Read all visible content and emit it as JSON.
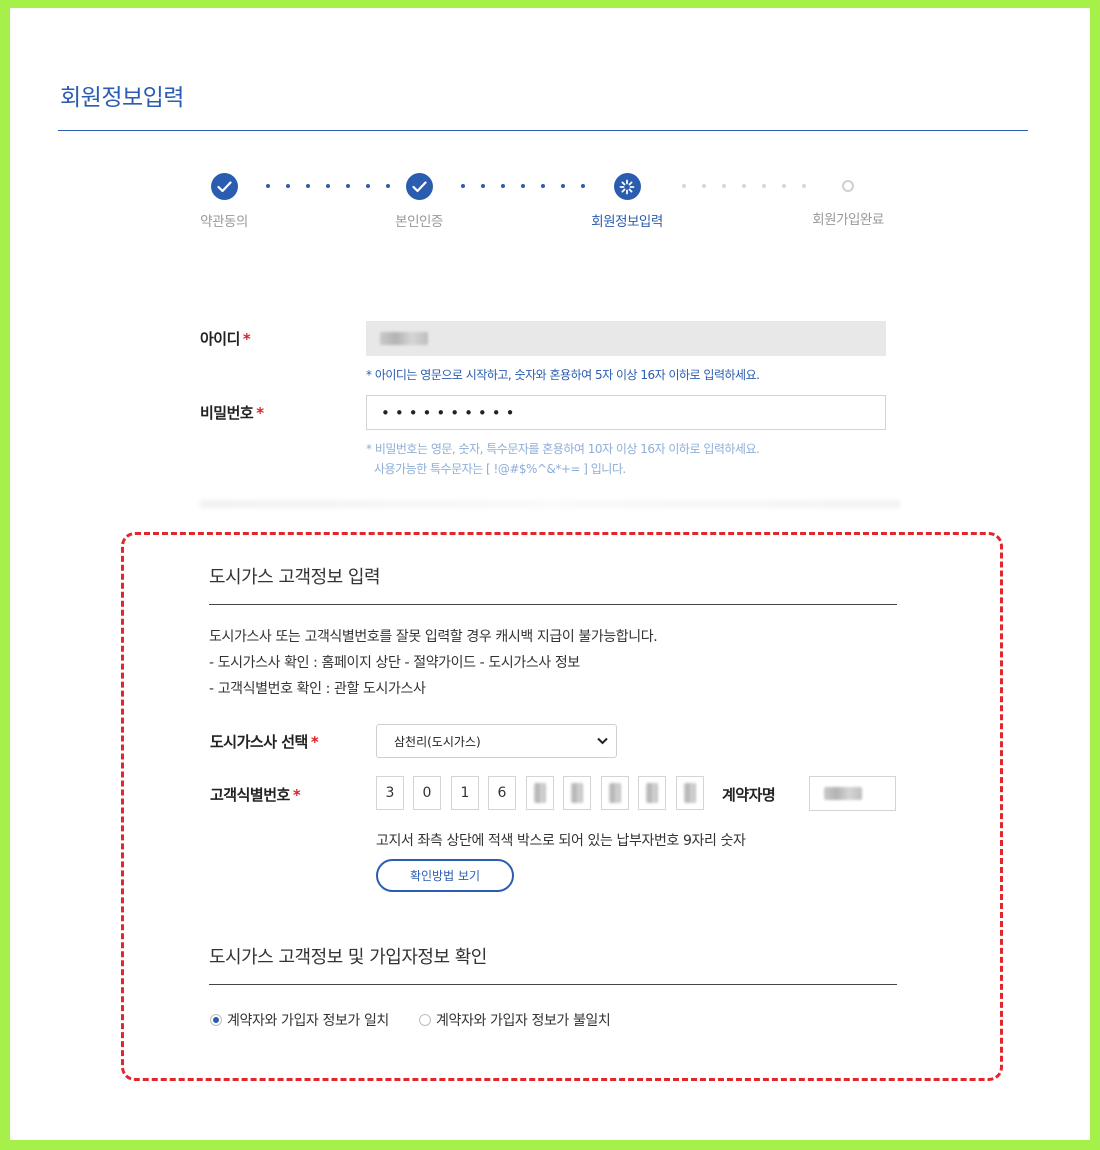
{
  "page_title": "회원정보입력",
  "steps": [
    {
      "label": "약관동의",
      "state": "done"
    },
    {
      "label": "본인인증",
      "state": "done"
    },
    {
      "label": "회원정보입력",
      "state": "active"
    },
    {
      "label": "회원가입완료",
      "state": "pending"
    }
  ],
  "form": {
    "id_label": "아이디",
    "id_hint": "* 아이디는 영문으로 시작하고, 숫자와 혼용하여 5자 이상 16자 이하로 입력하세요.",
    "pw_label": "비밀번호",
    "pw_value": "••••••••••",
    "pw_hint_1": "* 비밀번호는 영문, 숫자, 특수문자를 혼용하여 10자 이상 16자 이하로 입력하세요.",
    "pw_hint_2": "사용가능한 특수문자는 [ !@#$%^&*+= ] 입니다.",
    "required_mark": "*"
  },
  "gas_section": {
    "title": "도시가스 고객정보 입력",
    "notice_lines": [
      "도시가스사 또는 고객식별번호를 잘못 입력할 경우 캐시백 지급이 불가능합니다.",
      "- 도시가스사 확인 : 홈페이지 상단 - 절약가이드 - 도시가스사 정보",
      "- 고객식별번호 확인 : 관할 도시가스사"
    ],
    "company_label": "도시가스사 선택",
    "company_selected": "삼천리(도시가스)",
    "customer_no_label": "고객식별번호",
    "customer_digits": [
      "3",
      "0",
      "1",
      "6"
    ],
    "contractor_label": "계약자명",
    "customer_no_hint": "고지서 좌측 상단에 적색 박스로 되어 있는 납부자번호 9자리 숫자",
    "method_button": "확인방법 보기"
  },
  "confirm_section": {
    "title": "도시가스 고객정보 및 가입자정보 확인",
    "option_match": "계약자와 가입자 정보가 일치",
    "option_mismatch": "계약자와 가입자 정보가 불일치",
    "selected": "match"
  },
  "colors": {
    "accent": "#2a5db0",
    "required": "#e0202a",
    "highlight_border": "#e3262e",
    "frame": "#a6f04a"
  }
}
